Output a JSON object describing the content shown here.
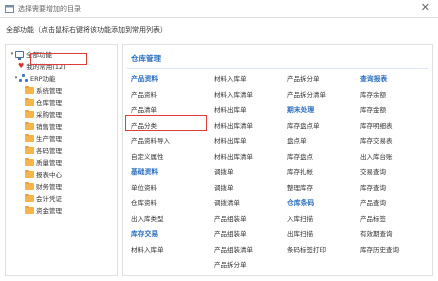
{
  "window": {
    "title": "选择需要增加的目录",
    "close_glyph": "✕"
  },
  "hint": "全部功能（点击鼠标右键将该功能添加到常用列表）",
  "tree": {
    "root": "全部功能",
    "favorites": "我的常用(12)",
    "erp": "ERP功能",
    "items": [
      "系统管理",
      "仓库管理",
      "采购管理",
      "销售管理",
      "生产管理",
      "各码管理",
      "质量管理",
      "报表中心",
      "财务管理",
      "会计凭证",
      "资金管理"
    ],
    "selected": "仓库管理"
  },
  "panel": {
    "heading": "仓库管理",
    "columns": [
      [
        {
          "text": "产品资料",
          "group": true
        },
        {
          "text": "产品资料"
        },
        {
          "text": "产品清单"
        },
        {
          "text": "产品分类",
          "highlight": true
        },
        {
          "text": "产品资料导入"
        },
        {
          "text": "自定义属性"
        },
        {
          "text": "基础资料",
          "group": true
        },
        {
          "text": "单位资料"
        },
        {
          "text": "仓库资料"
        },
        {
          "text": "出入库类型"
        },
        {
          "text": "库存交易",
          "group": true
        },
        {
          "text": "材料入库单"
        }
      ],
      [
        {
          "text": "材料入库单"
        },
        {
          "text": "材料入库清单"
        },
        {
          "text": "材料出库单"
        },
        {
          "text": "材料出库清单"
        },
        {
          "text": "材料出库单"
        },
        {
          "text": "材料出库清单"
        },
        {
          "text": "调拨单"
        },
        {
          "text": "调拨单"
        },
        {
          "text": "调拨清单"
        },
        {
          "text": "产品组装单"
        },
        {
          "text": "产品组装单"
        },
        {
          "text": "产品组装清单"
        },
        {
          "text": "产品拆分单"
        }
      ],
      [
        {
          "text": "产品拆分单"
        },
        {
          "text": "产品拆分清单"
        },
        {
          "text": "期末处理",
          "group": true
        },
        {
          "text": "库存盘点单"
        },
        {
          "text": "盘点单"
        },
        {
          "text": "库存盘点"
        },
        {
          "text": "库存扎帐"
        },
        {
          "text": "整理库存"
        },
        {
          "text": "仓库条码",
          "group": true
        },
        {
          "text": "入库扫描"
        },
        {
          "text": "出库扫描"
        },
        {
          "text": "条码标签打印"
        }
      ],
      [
        {
          "text": "查询报表",
          "group": true
        },
        {
          "text": "库存余额"
        },
        {
          "text": "库存金额"
        },
        {
          "text": "库存明细表"
        },
        {
          "text": "库存交易表"
        },
        {
          "text": "出入库台账"
        },
        {
          "text": "交易查询"
        },
        {
          "text": "库存查询"
        },
        {
          "text": "产品查询"
        },
        {
          "text": "产品标签"
        },
        {
          "text": "有效期查询"
        },
        {
          "text": "库存历史查询"
        }
      ]
    ]
  }
}
